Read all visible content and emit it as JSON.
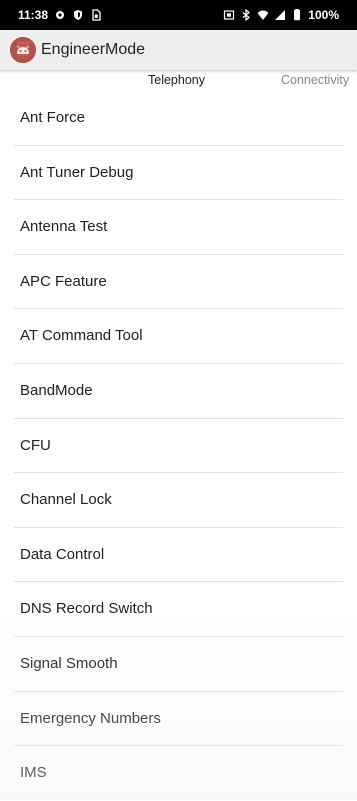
{
  "status_bar": {
    "time": "11:38",
    "battery": "100%",
    "left_icons": [
      "settings-icon",
      "shield-icon",
      "sim-card-icon"
    ],
    "right_icons": [
      "vibrate-icon",
      "bluetooth-icon",
      "wifi-icon",
      "signal-icon",
      "battery-icon"
    ]
  },
  "app_bar": {
    "title": "EngineerMode",
    "logo_icon": "android-icon"
  },
  "tabs": [
    {
      "label": "Telephony"
    },
    {
      "label": "Connectivity"
    }
  ],
  "list": {
    "items": [
      {
        "label": "Ant Force"
      },
      {
        "label": "Ant Tuner Debug"
      },
      {
        "label": "Antenna Test"
      },
      {
        "label": "APC Feature"
      },
      {
        "label": "AT Command Tool"
      },
      {
        "label": "BandMode"
      },
      {
        "label": "CFU"
      },
      {
        "label": "Channel Lock"
      },
      {
        "label": "Data Control"
      },
      {
        "label": "DNS Record Switch"
      },
      {
        "label": "Signal Smooth"
      },
      {
        "label": "Emergency Numbers"
      },
      {
        "label": "IMS"
      }
    ]
  },
  "colors": {
    "status_bar_bg": "#000000",
    "app_bar_bg": "#eeeeee",
    "logo_bg": "#b3524a",
    "divider": "#e2e2e2"
  }
}
